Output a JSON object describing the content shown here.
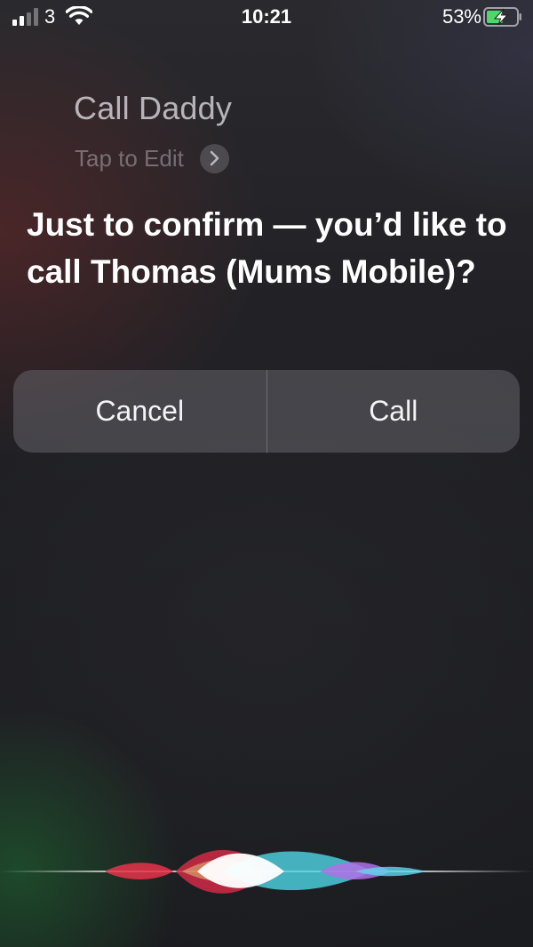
{
  "status_bar": {
    "carrier": "3",
    "time": "10:21",
    "battery_percent": "53%",
    "battery_state": "charging",
    "signal_strength": 2,
    "signal_strength_max": 4,
    "icons": [
      "signal-bars-icon",
      "wifi-icon",
      "battery-charging-icon"
    ]
  },
  "query": {
    "text": "Call Daddy",
    "edit_label": "Tap to Edit",
    "edit_icon": "chevron-right-icon"
  },
  "response": {
    "text": "Just to confirm — you’d like to call Thomas (Mums Mobile)?"
  },
  "actions": {
    "cancel_label": "Cancel",
    "call_label": "Call"
  },
  "siri": {
    "icon": "siri-waveform-icon",
    "colors": {
      "red": "#e8324a",
      "white": "#ffffff",
      "cyan": "#4fd6e6",
      "purple": "#b070e8"
    }
  }
}
